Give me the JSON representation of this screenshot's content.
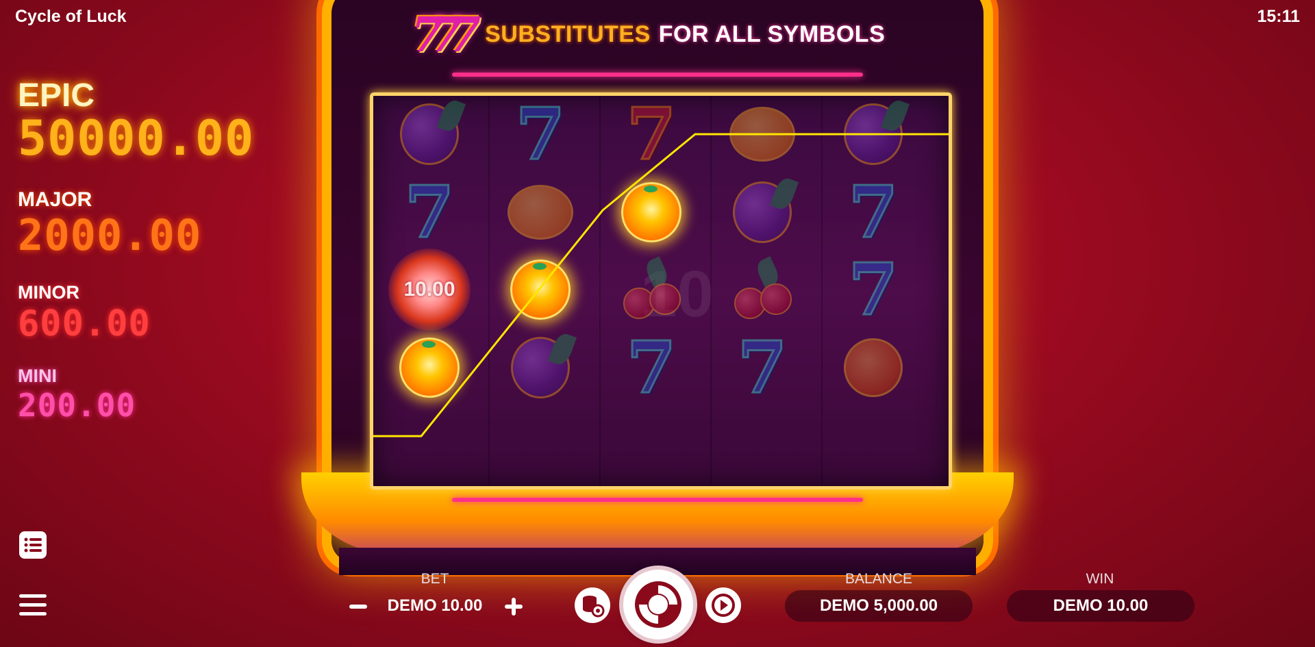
{
  "header": {
    "title": "Cycle of Luck",
    "clock": "15:11"
  },
  "jackpots": {
    "epic": {
      "label": "EPIC",
      "value": "50000.00"
    },
    "major": {
      "label": "MAJOR",
      "value": "2000.00"
    },
    "minor": {
      "label": "MINOR",
      "value": "600.00"
    },
    "mini": {
      "label": "MINI",
      "value": "200.00"
    }
  },
  "banner": {
    "logo": "777",
    "highlight": "SUBSTITUTES",
    "rest": "FOR ALL SYMBOLS"
  },
  "reels": {
    "bonus_value": "10.00",
    "ghost_text": "10",
    "grid": [
      [
        "plum",
        "seven",
        "seven-red",
        "lemon",
        "plum"
      ],
      [
        "seven",
        "lemon",
        "win-orange",
        "plum",
        "seven"
      ],
      [
        "bonus",
        "win-orange",
        "cherry",
        "cherry",
        "seven"
      ],
      [
        "win-orange",
        "plum",
        "seven",
        "seven",
        "orange"
      ]
    ]
  },
  "controls": {
    "bet_label": "BET",
    "bet_value": "DEMO 10.00",
    "balance_label": "BALANCE",
    "balance_value": "DEMO 5,000.00",
    "win_label": "WIN",
    "win_value": "DEMO 10.00",
    "icons": {
      "paytable": "list-icon",
      "menu": "hamburger-menu-icon",
      "minus": "minus-icon",
      "plus": "plus-icon",
      "coins_settings": "coins-gear-icon",
      "spin": "spin-icon",
      "autoplay": "autoplay-icon"
    }
  },
  "colors": {
    "epic": "#ffb21a",
    "major": "#ff7418",
    "minor": "#ff3f3f",
    "mini": "#ff4fa8",
    "frame": "#ffb000",
    "payline": "#ffe600"
  }
}
